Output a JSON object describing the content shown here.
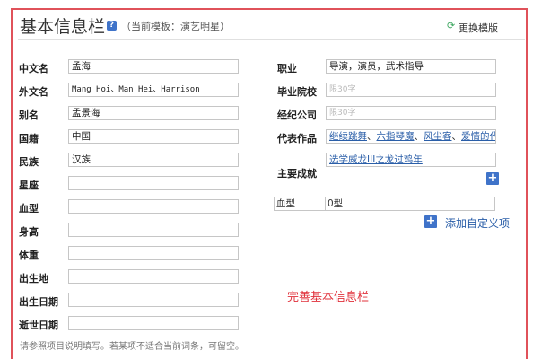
{
  "header": {
    "title": "基本信息栏",
    "help_icon": "?",
    "template_label": "（当前模板：演艺明星）",
    "switch_label": "更换模版",
    "switch_icon": "refresh-icon"
  },
  "left_fields": [
    {
      "label": "中文名",
      "value": "孟海"
    },
    {
      "label": "外文名",
      "value": "Mang Hoi、Man Hei、Harrison"
    },
    {
      "label": "别名",
      "value": "孟景海"
    },
    {
      "label": "国籍",
      "value": "中国"
    },
    {
      "label": "民族",
      "value": "汉族"
    },
    {
      "label": "星座",
      "value": ""
    },
    {
      "label": "血型",
      "value": ""
    },
    {
      "label": "身高",
      "value": ""
    },
    {
      "label": "体重",
      "value": ""
    },
    {
      "label": "出生地",
      "value": ""
    },
    {
      "label": "出生日期",
      "value": ""
    },
    {
      "label": "逝世日期",
      "value": ""
    }
  ],
  "right_fields": {
    "occupation": {
      "label": "职业",
      "value": "导演，演员，武术指导"
    },
    "school": {
      "label": "毕业院校",
      "placeholder": "限30字"
    },
    "agency": {
      "label": "经纪公司",
      "placeholder": "限30字"
    },
    "works": {
      "label": "代表作品",
      "items": [
        "继续跳舞",
        "六指琴魔",
        "风尘客",
        "爱情的代价"
      ]
    },
    "achievements": {
      "label": "主要成就",
      "items": [
        "选学威龙III之龙过鸡年"
      ]
    }
  },
  "custom_row": {
    "key": "血型",
    "value": "0型"
  },
  "add_custom_label": "添加自定义项",
  "annotation": "完善基本信息栏",
  "footer": "请参照项目说明填写。若某项不适合当前词条，可留空。",
  "colors": {
    "frame": "#e0525a",
    "accent": "#3f73c9",
    "link": "#2a5ea8"
  }
}
